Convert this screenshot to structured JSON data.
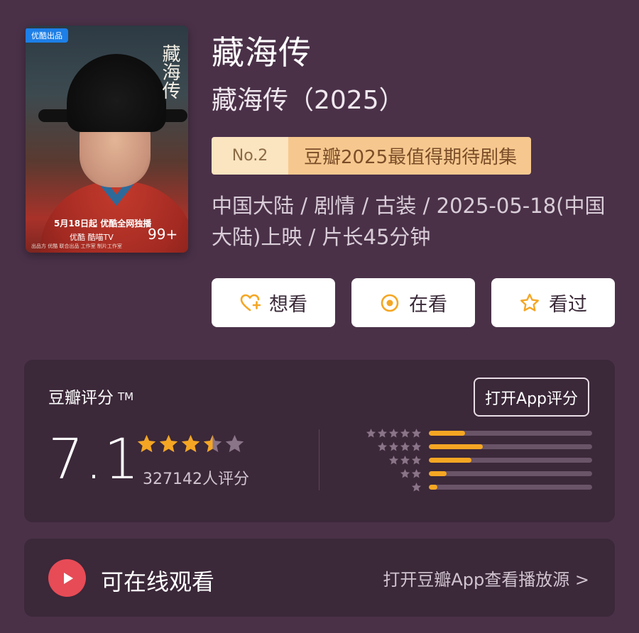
{
  "poster": {
    "badge": "优酷出品",
    "vertical_title": "藏海传",
    "release_text": "5月18日起 优酷全网独播",
    "platforms": "优酷  酷喵TV",
    "age": "99+",
    "credit": "出品方 优酷   联合出品   工作室   制片工作室"
  },
  "title": "藏海传",
  "subtitle": "藏海传（2025）",
  "rank": {
    "number": "No.2",
    "list_name": "豆瓣2025最值得期待剧集"
  },
  "meta": "中国大陆 / 剧情 / 古装 / 2025-05-18(中国大陆)上映 / 片长45分钟",
  "actions": [
    {
      "label": "想看",
      "icon": "heart-plus-icon"
    },
    {
      "label": "在看",
      "icon": "target-icon"
    },
    {
      "label": "看过",
      "icon": "star-outline-icon"
    }
  ],
  "rating": {
    "label": "豆瓣评分",
    "tm": "TM",
    "open_app_label": "打开App评分",
    "score": "7.1",
    "stars": 3.5,
    "votes": "327142人评分",
    "distribution": [
      {
        "stars": 5,
        "fraction": 0.22
      },
      {
        "stars": 4,
        "fraction": 0.33
      },
      {
        "stars": 3,
        "fraction": 0.26
      },
      {
        "stars": 2,
        "fraction": 0.11
      },
      {
        "stars": 1,
        "fraction": 0.05
      }
    ]
  },
  "watch": {
    "title": "可在线观看",
    "link": "打开豆瓣App查看播放源 >"
  },
  "colors": {
    "background": "#4a3148",
    "card": "#3b2839",
    "star": "#f5a623",
    "play": "#e74b56"
  }
}
